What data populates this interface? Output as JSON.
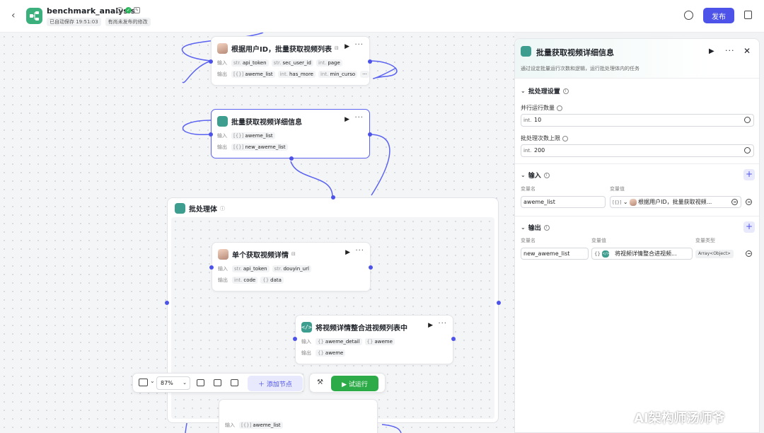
{
  "header": {
    "title": "benchmark_analysis",
    "autosave": "已自动保存 19:51:03",
    "unpublished": "有尚未发布的修改",
    "publish_label": "发布"
  },
  "nodes": {
    "n1": {
      "title": "根据用户ID，批量获取视频列表",
      "input_label": "输入",
      "output_label": "输出",
      "inputs": [
        [
          "str.",
          "api_token"
        ],
        [
          "str.",
          "sec_user_id"
        ],
        [
          "int.",
          "page"
        ]
      ],
      "outputs": [
        [
          "[{}]",
          "aweme_list"
        ],
        [
          "int.",
          "has_more"
        ],
        [
          "int.",
          "min_curso"
        ]
      ]
    },
    "n2": {
      "title": "批量获取视频详细信息",
      "input_label": "输入",
      "output_label": "输出",
      "inputs": [
        [
          "[{}]",
          "aweme_list"
        ]
      ],
      "outputs": [
        [
          "[{}]",
          "new_aweme_list"
        ]
      ]
    },
    "group_title": "批处理体",
    "n3": {
      "title": "单个获取视频详情",
      "input_label": "输入",
      "output_label": "输出",
      "inputs": [
        [
          "str.",
          "api_token"
        ],
        [
          "str.",
          "douyin_url"
        ]
      ],
      "outputs": [
        [
          "int.",
          "code"
        ],
        [
          "{}",
          "data"
        ]
      ]
    },
    "n4": {
      "title": "将视频详情整合进视频列表中",
      "input_label": "输入",
      "output_label": "输出",
      "inputs": [
        [
          "{}",
          "aweme_detail"
        ],
        [
          "{}",
          "aweme"
        ]
      ],
      "outputs": [
        [
          "{}",
          "aweme"
        ]
      ]
    },
    "n5": {
      "input_label": "输入",
      "inputs": [
        [
          "[{}]",
          "aweme_list"
        ]
      ]
    }
  },
  "toolbar": {
    "zoom": "87%",
    "add_node": "添加节点",
    "run": "试运行"
  },
  "panel": {
    "title": "批量获取视频详细信息",
    "description": "通过设定批量运行次数和逻辑，运行批处理体内的任务",
    "batch_settings": {
      "title": "批处理设置",
      "parallel_label": "并行运行数量",
      "parallel_type": "int.",
      "parallel_value": "10",
      "limit_label": "批处理次数上限",
      "limit_type": "int.",
      "limit_value": "200"
    },
    "input_section": {
      "title": "输入",
      "col_name": "变量名",
      "col_value": "变量值",
      "var_name": "aweme_list",
      "ref_type": "[{}]",
      "ref_text": "根据用户ID，批量获取视频..."
    },
    "output_section": {
      "title": "输出",
      "col_name": "变量名",
      "col_value": "变量值",
      "col_type": "变量类型",
      "var_name": "new_aweme_list",
      "ref_type": "{}",
      "ref_text": "将视频详情整合进视频...",
      "type": "Array<Object>"
    }
  },
  "watermark": "AI架构师汤师爷",
  "colors": {
    "accent": "#4d53e8",
    "run_green": "#2dab49",
    "node_teal": "#3d9e8f",
    "logo_green": "#3bb07d"
  }
}
